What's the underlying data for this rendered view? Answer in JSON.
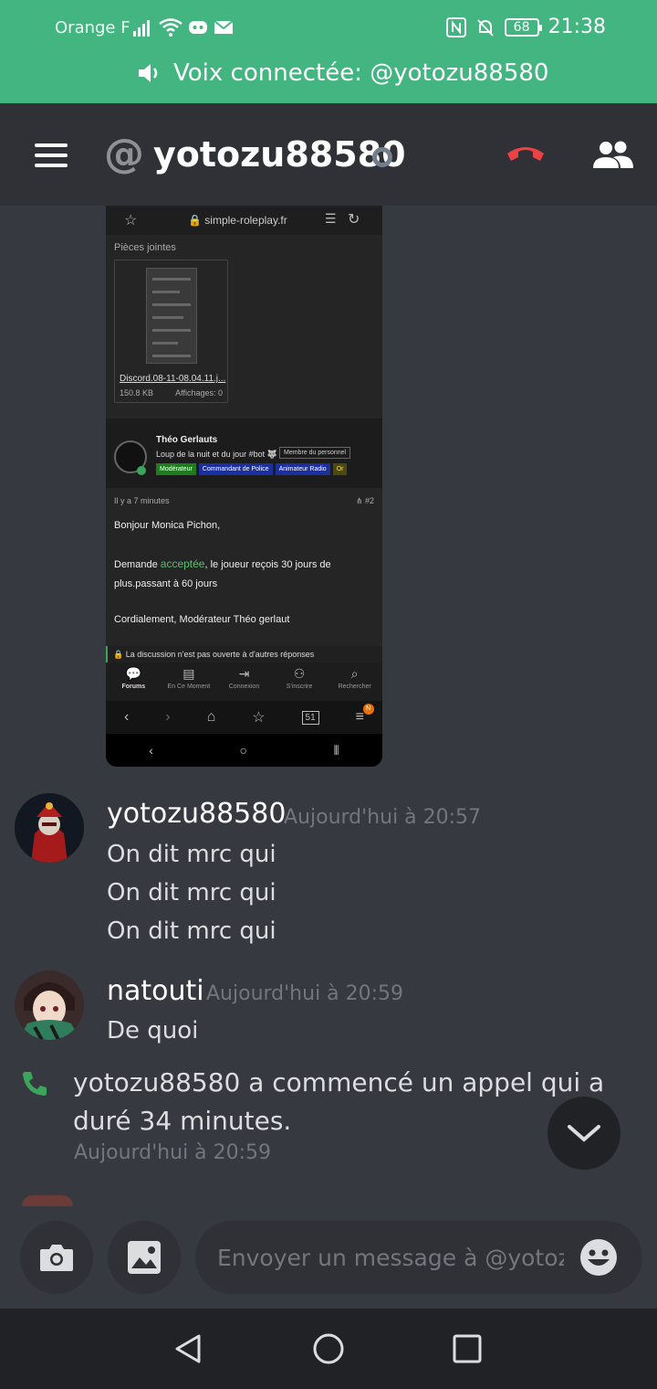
{
  "status_bar": {
    "carrier": "Orange F",
    "battery": "68",
    "time": "21:38"
  },
  "voice_banner": {
    "text": "Voix connectée: @yotozu88580"
  },
  "header": {
    "at_symbol": "@",
    "username": "yotozu88580"
  },
  "embedded_screenshot": {
    "url": "simple-roleplay.fr",
    "attachments_title": "Pièces jointes",
    "file_name": "Discord.08-11-08.04.11.j...",
    "file_size": "150.8 KB",
    "file_views": "Affichages: 0",
    "profile_name": "Théo Gerlauts",
    "profile_tagline": "Loup de la nuit et du jour #bot 🐺",
    "profile_badge": "Membre du personnel",
    "roles": [
      "Modérateur",
      "Commandant de Police",
      "Animateur Radio",
      "Or"
    ],
    "post_time": "Il y a 7 minutes",
    "post_number": "#2",
    "post_greeting": "Bonjour Monica Pichon,",
    "post_line_before": "Demande ",
    "post_highlight": "acceptée",
    "post_line_after": ", le joueur reçois 30 jours de plus.passant à 60 jours",
    "post_signature": "Cordialement, Modérateur Théo gerlaut",
    "locked_notice": "La discussion n'est pas ouverte à d'autres réponses",
    "forum_nav": [
      "Forums",
      "En Ce Moment",
      "Connexion",
      "S'inscrire",
      "Rechercher"
    ],
    "tabs_count": "51",
    "menu_badge": "N"
  },
  "messages": [
    {
      "author": "yotozu88580",
      "timestamp": "Aujourd'hui à 20:57",
      "lines": [
        "On dit mrc qui",
        "On dit mrc qui",
        "On dit mrc qui"
      ]
    },
    {
      "author": "natouti",
      "timestamp": "Aujourd'hui à 20:59",
      "lines": [
        "De quoi"
      ]
    }
  ],
  "call_event": {
    "text": "yotozu88580 a commencé un appel qui a duré 34 minutes.",
    "timestamp": "Aujourd'hui à 20:59"
  },
  "composer": {
    "placeholder": "Envoyer un message à @yotoz..."
  },
  "colors": {
    "voice_green": "#43b581",
    "hangup_red": "#ed4245",
    "background": "#36393f",
    "header": "#2f3136"
  },
  "icons": [
    "menu-icon",
    "hangup-icon",
    "members-icon",
    "phone-icon",
    "chevron-down-icon",
    "camera-icon",
    "image-icon",
    "emoji-icon",
    "back-icon",
    "home-icon",
    "recents-icon",
    "speaker-icon"
  ]
}
